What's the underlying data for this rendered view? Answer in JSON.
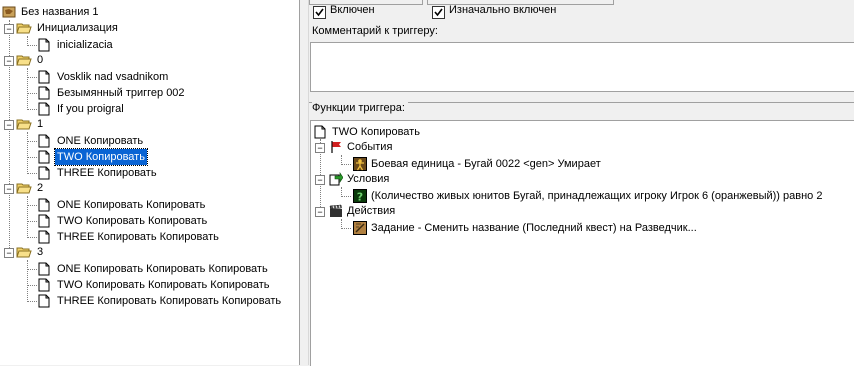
{
  "tree": {
    "root": "Без названия 1",
    "groups": [
      {
        "label": "Инициализация",
        "items": [
          "inicializacia"
        ]
      },
      {
        "label": "0",
        "items": [
          "Vosklik nad vsadnikom",
          "Безымянный триггер 002",
          "If you proigral"
        ]
      },
      {
        "label": "1",
        "items": [
          "ONE Копировать",
          "TWO Копировать",
          "THREE Копировать"
        ]
      },
      {
        "label": "2",
        "items": [
          "ONE Копировать Копировать",
          "TWO Копировать Копировать",
          "THREE Копировать Копировать"
        ]
      },
      {
        "label": "3",
        "items": [
          "ONE Копировать Копировать Копировать",
          "TWO Копировать Копировать Копировать",
          "THREE Копировать Копировать Копировать"
        ]
      }
    ],
    "selected": "TWO Копировать"
  },
  "options": {
    "enabled_label": "Включен",
    "enabled_checked": true,
    "initially_on_label": "Изначально включен",
    "initially_on_checked": true
  },
  "comment": {
    "label": "Комментарий к триггеру:",
    "value": ""
  },
  "functions": {
    "label": "Функции триггера:",
    "trigger_name": "TWO Копировать",
    "events_label": "События",
    "event_item": "Боевая единица - Бугай 0022 <gen> Умирает",
    "conditions_label": "Условия",
    "condition_item": "(Количество живых юнитов Бугай, принадлежащих игроку Игрок 6 (оранжевый)) равно 2",
    "actions_label": "Действия",
    "action_item": "Задание - Сменить название (Последний квест) на Разведчик..."
  },
  "colors": {
    "selection": "#0a64d4",
    "folder": "#f3d36b",
    "event_flag": "#d02020",
    "condition_icon": "#2a9a2a",
    "action_icon": "#404040"
  }
}
